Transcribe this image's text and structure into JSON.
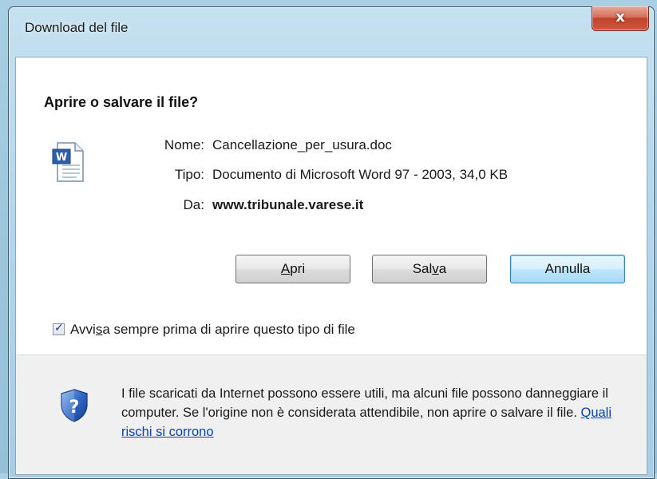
{
  "window": {
    "title": "Download del file",
    "close_symbol": "x"
  },
  "header": "Aprire o salvare il file?",
  "icons": {
    "file": "word-document-icon",
    "shield": "security-shield-question-icon",
    "close": "close-icon"
  },
  "file_info": {
    "name_label": "Nome:",
    "name_value": "Cancellazione_per_usura.doc",
    "type_label": "Tipo:",
    "type_value": "Documento di Microsoft Word 97 - 2003, 34,0 KB",
    "from_label": "Da:",
    "from_value": "www.tribunale.varese.it"
  },
  "buttons": {
    "open": {
      "pre": "",
      "accel": "A",
      "post": "pri"
    },
    "save": {
      "pre": "Sal",
      "accel": "v",
      "post": "a"
    },
    "cancel": "Annulla"
  },
  "checkbox": {
    "checked": true,
    "label_pre": "Avvi",
    "label_accel": "s",
    "label_post": "a sempre prima di aprire questo tipo di file"
  },
  "warning": {
    "text": "I file scaricati da Internet possono essere utili, ma alcuni file possono danneggiare il computer. Se l'origine non è considerata attendibile, non aprire o salvare il file.",
    "link": "Quali rischi si corrono"
  },
  "colors": {
    "link": "#0645ad",
    "close_button": "#c0412a",
    "default_button_border": "#3c7fb1"
  }
}
